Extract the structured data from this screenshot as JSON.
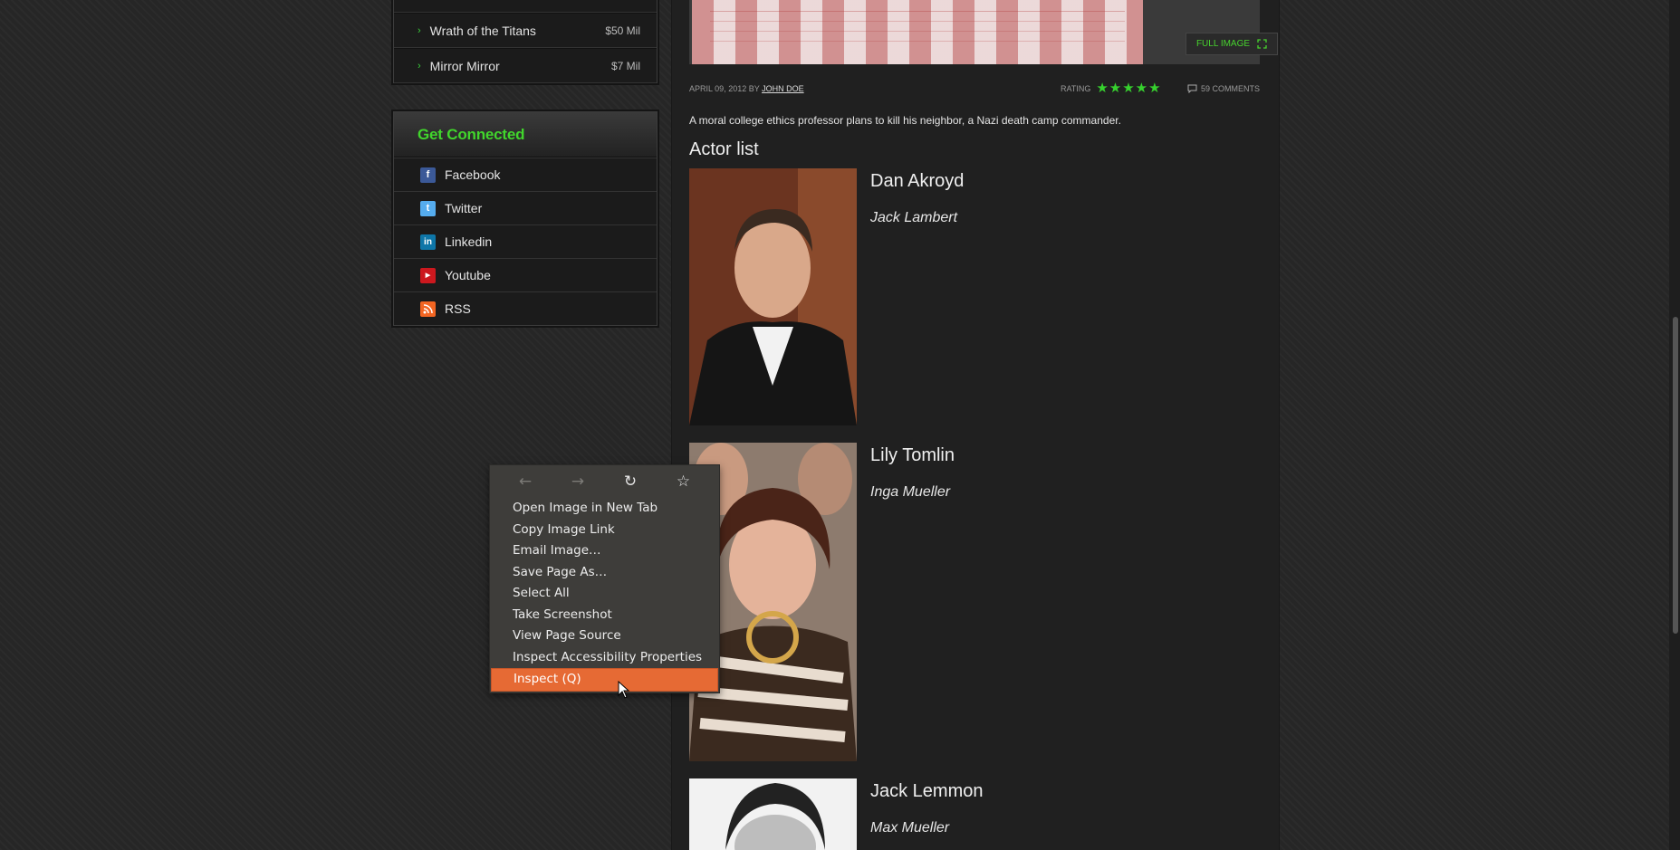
{
  "movies_list": [
    {
      "title": "Wrath of the Titans",
      "gross": "$50 Mil"
    },
    {
      "title": "Mirror Mirror",
      "gross": "$7 Mil"
    }
  ],
  "get_connected": {
    "heading": "Get Connected",
    "links": [
      {
        "label": "Facebook",
        "icon": "facebook-icon",
        "color": "#3b5998"
      },
      {
        "label": "Twitter",
        "icon": "twitter-icon",
        "color": "#55acee"
      },
      {
        "label": "Linkedin",
        "icon": "linkedin-icon",
        "color": "#0e76a8"
      },
      {
        "label": "Youtube",
        "icon": "youtube-icon",
        "color": "#cc181e"
      },
      {
        "label": "RSS",
        "icon": "rss-icon",
        "color": "#f26522"
      }
    ]
  },
  "post": {
    "full_image_label": "FULL IMAGE",
    "date": "APRIL 09, 2012 BY",
    "author": "JOHN DOE",
    "rating_label": "RATING",
    "rating_value": 5,
    "comments": "59 COMMENTS",
    "description": "A moral college ethics professor plans to kill his neighbor, a Nazi death camp commander.",
    "actor_list_heading": "Actor list",
    "actors": [
      {
        "name": "Dan Akroyd",
        "role": "Jack Lambert"
      },
      {
        "name": "Lily Tomlin",
        "role": "Inga Mueller"
      },
      {
        "name": "Jack Lemmon",
        "role": "Max Mueller"
      }
    ]
  },
  "context_menu": {
    "nav": {
      "back": "←",
      "forward": "→",
      "reload": "↻",
      "bookmark": "☆"
    },
    "items": [
      {
        "label": "Open Image in New Tab"
      },
      {
        "label": "Copy Image Link"
      },
      {
        "label": "Email Image…"
      },
      {
        "label": "Save Page As…"
      },
      {
        "label": "Select All"
      },
      {
        "label": "Take Screenshot"
      },
      {
        "label": "View Page Source"
      },
      {
        "label": "Inspect Accessibility Properties"
      },
      {
        "label": "Inspect (Q)",
        "highlighted": true
      }
    ]
  },
  "colors": {
    "accent_green": "#41d62c",
    "menu_highlight": "#e66a34"
  }
}
